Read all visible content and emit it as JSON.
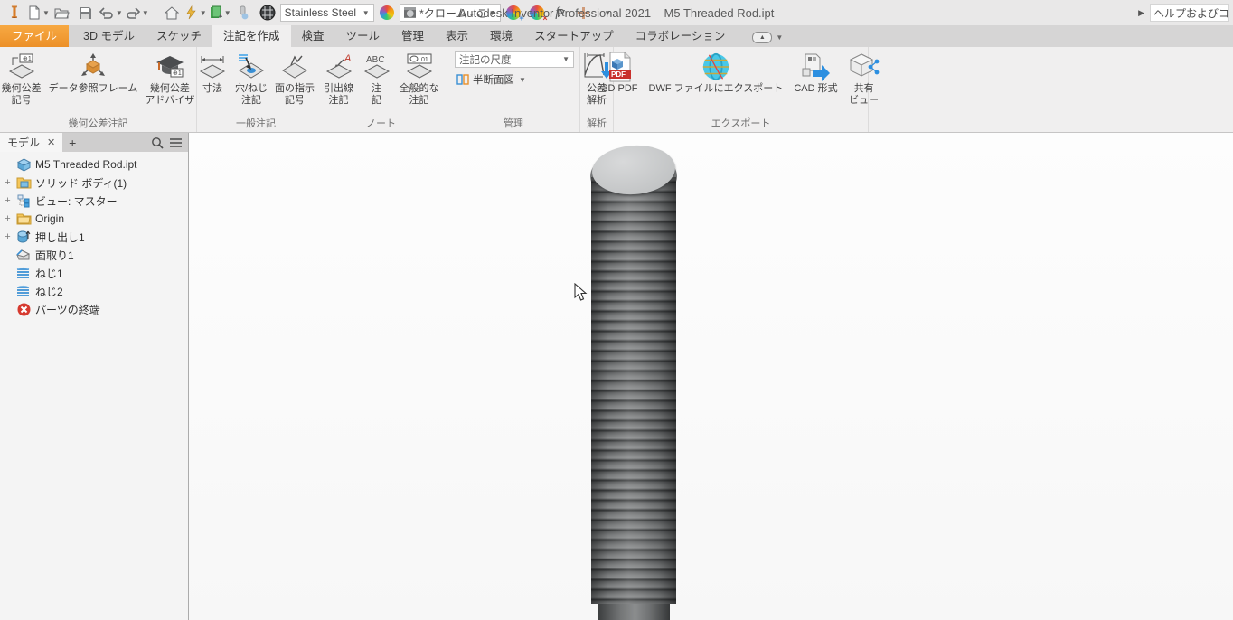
{
  "titlebar": {
    "app_title": "Autodesk Inventor Professional 2021",
    "doc_title": "M5 Threaded Rod.ipt",
    "material_value": "Stainless Steel",
    "appearance_value": "*クローム - こ",
    "fx_label": "fx",
    "help_text": "ヘルプおよびコマン"
  },
  "tabs": [
    {
      "label": "ファイル"
    },
    {
      "label": "3D モデル"
    },
    {
      "label": "スケッチ"
    },
    {
      "label": "注記を作成"
    },
    {
      "label": "検査"
    },
    {
      "label": "ツール"
    },
    {
      "label": "管理"
    },
    {
      "label": "表示"
    },
    {
      "label": "環境"
    },
    {
      "label": "スタートアップ"
    },
    {
      "label": "コラボレーション"
    }
  ],
  "ribbon": {
    "groups": [
      {
        "label": "幾何公差注記",
        "buttons": [
          {
            "line1": "幾何公差",
            "line2": "記号"
          },
          {
            "line1": "データ参照フレーム",
            "line2": ""
          },
          {
            "line1": "幾何公差",
            "line2": "アドバイザ"
          }
        ]
      },
      {
        "label": "一般注記",
        "buttons": [
          {
            "line1": "寸法",
            "line2": ""
          },
          {
            "line1": "穴/ねじ",
            "line2": "注記"
          },
          {
            "line1": "面の指示",
            "line2": "記号"
          }
        ]
      },
      {
        "label": "ノート",
        "buttons": [
          {
            "line1": "引出線",
            "line2": "注記"
          },
          {
            "line1": "注",
            "line2": "記"
          },
          {
            "line1": "全般的な",
            "line2": "注記"
          }
        ]
      },
      {
        "label": "管理",
        "scale_placeholder": "注記の尺度",
        "half_section_label": "半断面図"
      },
      {
        "label": "解析",
        "buttons": [
          {
            "line1": "公差",
            "line2": "解析"
          }
        ]
      },
      {
        "label": "エクスポート",
        "buttons": [
          {
            "line1": "3D PDF",
            "line2": ""
          },
          {
            "line1": "DWF ファイルにエクスポート",
            "line2": ""
          },
          {
            "line1": "CAD 形式",
            "line2": ""
          },
          {
            "line1": "共有",
            "line2": "ビュー"
          }
        ]
      }
    ]
  },
  "browser": {
    "tab_label": "モデル",
    "tree": [
      {
        "label": "M5 Threaded Rod.ipt"
      },
      {
        "label": "ソリッド ボディ(1)"
      },
      {
        "label": "ビュー: マスター"
      },
      {
        "label": "Origin"
      },
      {
        "label": "押し出し1"
      },
      {
        "label": "面取り1"
      },
      {
        "label": "ねじ1"
      },
      {
        "label": "ねじ2"
      },
      {
        "label": "パーツの終端"
      }
    ]
  }
}
